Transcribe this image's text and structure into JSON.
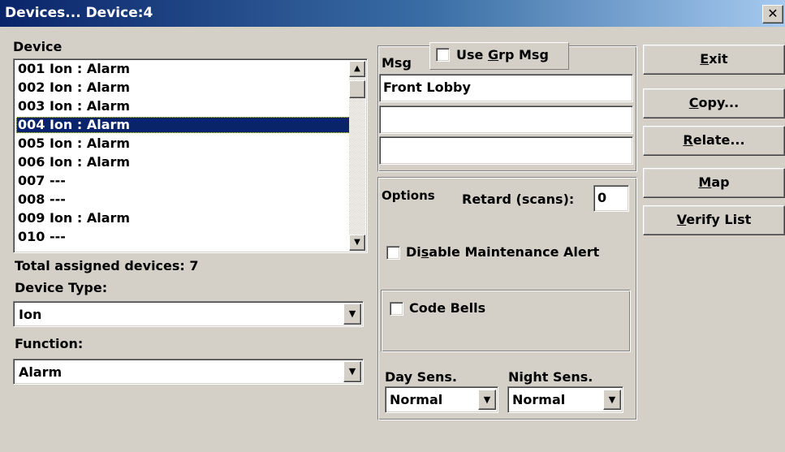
{
  "window": {
    "title": "Devices... Device:4",
    "close_glyph": "✕"
  },
  "device_section": {
    "label": "Device",
    "items": [
      "001 Ion : Alarm",
      "002 Ion : Alarm",
      "003 Ion : Alarm",
      "004 Ion : Alarm",
      "005 Ion : Alarm",
      "006 Ion : Alarm",
      "007 ---",
      "008 ---",
      "009 Ion : Alarm",
      "010 ---"
    ],
    "selected_index": 3,
    "total_label": "Total assigned devices:",
    "total_value": "7"
  },
  "device_type": {
    "label": "Device Type:",
    "value": "Ion"
  },
  "function": {
    "label": "Function:",
    "value": "Alarm"
  },
  "message": {
    "label": "Msg",
    "use_grp_msg": {
      "pre": "Use ",
      "accel": "G",
      "post": "rp Msg",
      "checked": false
    },
    "lines": [
      "Front Lobby",
      "",
      ""
    ]
  },
  "options": {
    "label": "Options",
    "retard_label": "Retard (scans):",
    "retard_value": "0",
    "disable_maintenance": {
      "pre": "Di",
      "accel": "s",
      "post": "able Maintenance Alert",
      "checked": false
    },
    "code_bells": {
      "label": "Code Bells",
      "checked": false
    },
    "day_sens": {
      "label": "Day Sens.",
      "value": "Normal"
    },
    "night_sens": {
      "label": "Night Sens.",
      "value": "Normal"
    }
  },
  "buttons": [
    {
      "accel": "E",
      "rest": "xit"
    },
    {
      "accel": "C",
      "rest": "opy..."
    },
    {
      "accel": "R",
      "rest": "elate..."
    },
    {
      "accel": "M",
      "rest": "ap"
    },
    {
      "accel": "V",
      "rest": "erify List"
    }
  ],
  "icons": {
    "scroll_up": "up-arrow-icon",
    "scroll_down": "down-arrow-icon",
    "dropdown": "dropdown-arrow-icon",
    "close": "close-icon"
  },
  "colors": {
    "title_start": "#0a246a",
    "title_end": "#a6caf0",
    "selection": "#0a246a",
    "face": "#d4d0c8"
  }
}
